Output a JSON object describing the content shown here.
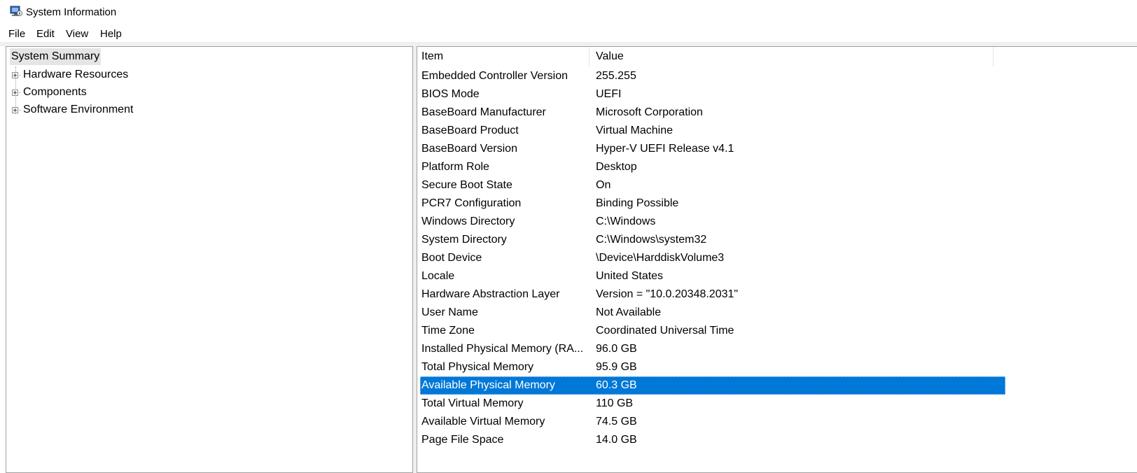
{
  "window": {
    "title": "System Information",
    "icon": "system-information-icon"
  },
  "menu": [
    "File",
    "Edit",
    "View",
    "Help"
  ],
  "tree": {
    "root": "System Summary",
    "children": [
      "Hardware Resources",
      "Components",
      "Software Environment"
    ]
  },
  "table": {
    "columns": [
      "Item",
      "Value"
    ],
    "selected_index": 17,
    "selection_color": "#0078d7",
    "rows": [
      {
        "item": "Embedded Controller Version",
        "value": "255.255"
      },
      {
        "item": "BIOS Mode",
        "value": "UEFI"
      },
      {
        "item": "BaseBoard Manufacturer",
        "value": "Microsoft Corporation"
      },
      {
        "item": "BaseBoard Product",
        "value": "Virtual Machine"
      },
      {
        "item": "BaseBoard Version",
        "value": "Hyper-V UEFI Release v4.1"
      },
      {
        "item": "Platform Role",
        "value": "Desktop"
      },
      {
        "item": "Secure Boot State",
        "value": "On"
      },
      {
        "item": "PCR7 Configuration",
        "value": "Binding Possible"
      },
      {
        "item": "Windows Directory",
        "value": "C:\\Windows"
      },
      {
        "item": "System Directory",
        "value": "C:\\Windows\\system32"
      },
      {
        "item": "Boot Device",
        "value": "\\Device\\HarddiskVolume3"
      },
      {
        "item": "Locale",
        "value": "United States"
      },
      {
        "item": "Hardware Abstraction Layer",
        "value": "Version = \"10.0.20348.2031\""
      },
      {
        "item": "User Name",
        "value": "Not Available"
      },
      {
        "item": "Time Zone",
        "value": "Coordinated Universal Time"
      },
      {
        "item": "Installed Physical Memory (RA...",
        "value": "96.0 GB"
      },
      {
        "item": "Total Physical Memory",
        "value": "95.9 GB"
      },
      {
        "item": "Available Physical Memory",
        "value": "60.3 GB"
      },
      {
        "item": "Total Virtual Memory",
        "value": "110 GB"
      },
      {
        "item": "Available Virtual Memory",
        "value": "74.5 GB"
      },
      {
        "item": "Page File Space",
        "value": "14.0 GB"
      }
    ]
  }
}
